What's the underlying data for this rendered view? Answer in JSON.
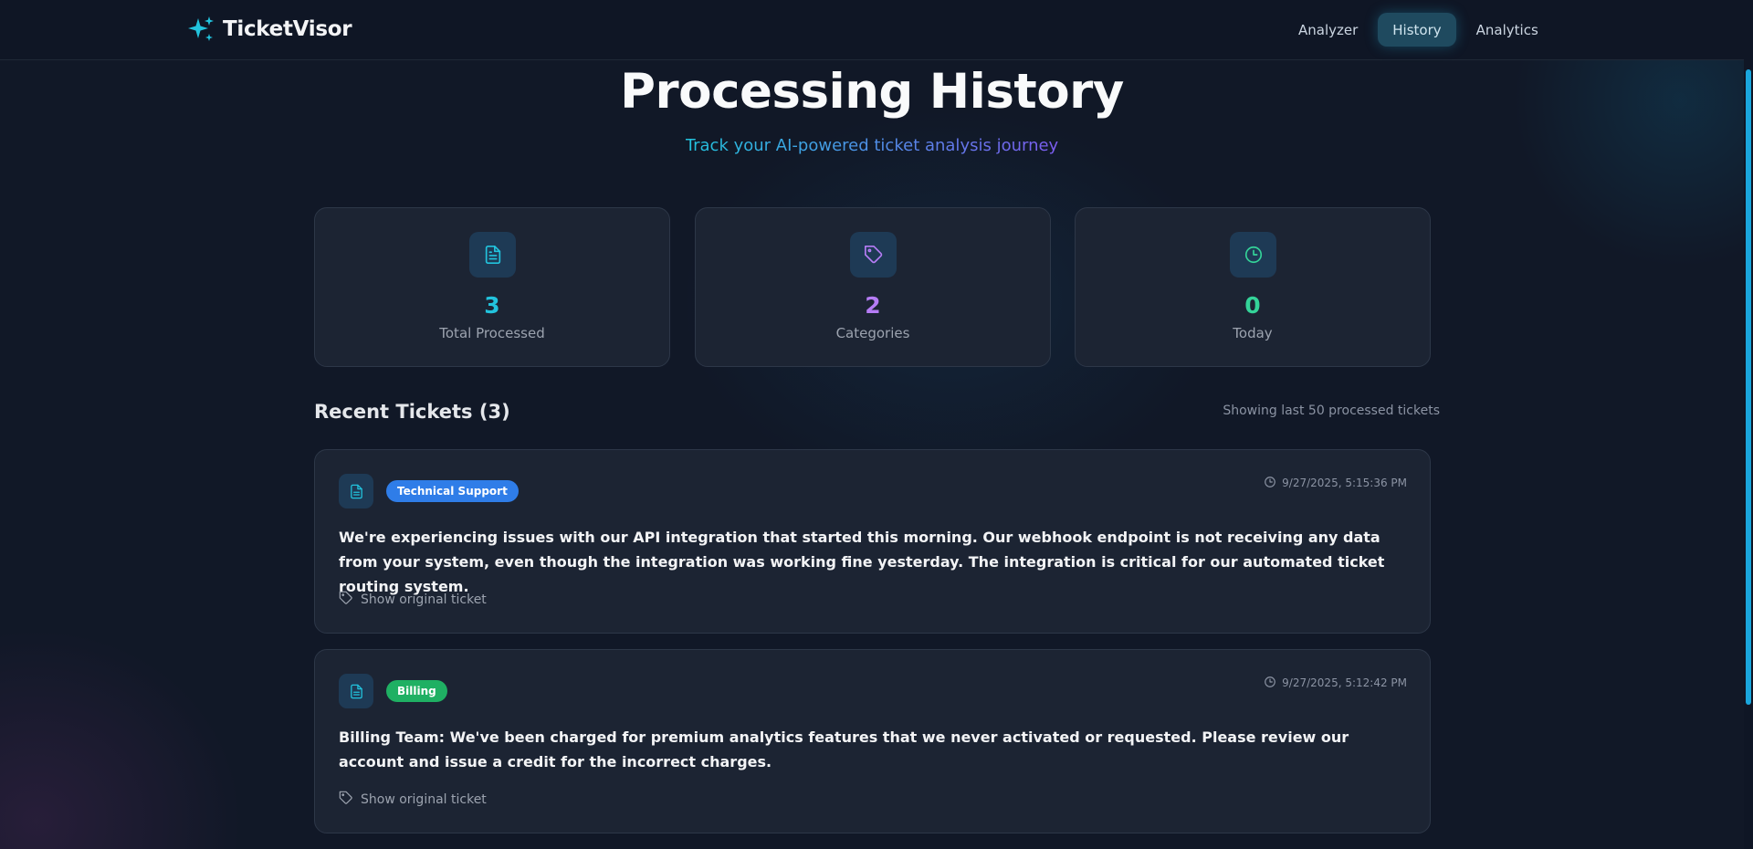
{
  "nav": {
    "brand": "TicketVisor",
    "links": [
      {
        "label": "Analyzer",
        "active": false
      },
      {
        "label": "History",
        "active": true
      },
      {
        "label": "Analytics",
        "active": false
      }
    ]
  },
  "header": {
    "title": "Processing History",
    "subtitle": "Track your AI-powered ticket analysis journey"
  },
  "stats": [
    {
      "icon": "document-icon",
      "value": "3",
      "label": "Total Processed",
      "color": "#22c3dd"
    },
    {
      "icon": "tag-icon",
      "value": "2",
      "label": "Categories",
      "color": "#b57cf5"
    },
    {
      "icon": "clock-icon",
      "value": "0",
      "label": "Today",
      "color": "#34d399"
    }
  ],
  "recent": {
    "title": "Recent Tickets (3)",
    "note": "Showing last 50 processed tickets"
  },
  "tickets": [
    {
      "category": "Technical Support",
      "category_color": "#2f7de8",
      "timestamp": "9/27/2025, 5:15:36 PM",
      "text": "We're experiencing issues with our API integration that started this morning. Our webhook endpoint is not receiving any data from your system, even though the integration was working fine yesterday. The integration is critical for our automated ticket routing system.",
      "toggle_label": "Show original ticket"
    },
    {
      "category": "Billing",
      "category_color": "#1fb063",
      "timestamp": "9/27/2025, 5:12:42 PM",
      "text": "Billing Team: We've been charged for premium analytics features that we never activated or requested. Please review our account and issue a credit for the incorrect charges.",
      "toggle_label": "Show original ticket"
    }
  ]
}
